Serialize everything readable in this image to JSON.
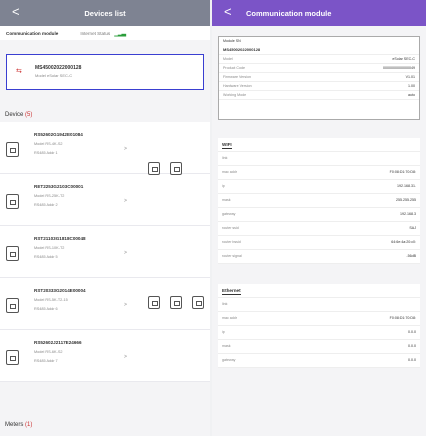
{
  "left": {
    "back": "<",
    "title": "Devices list",
    "tab_module": "Communication module",
    "tab_internet": "Internet Status",
    "module_card": {
      "sn": "MS45002022000128",
      "model": "Model eSolar SEC-C"
    },
    "device_title": "Device",
    "device_count": "(5)",
    "devices": [
      {
        "sn": "RS52602G1942E01084",
        "model": "Model RS-4K-S2",
        "addr": "RS485 Addr 1"
      },
      {
        "sn": "RET2253G2103C00001",
        "model": "Model RS-25K-T2",
        "addr": "RS485 Addr 2"
      },
      {
        "sn": "RST21103G1818C00048",
        "model": "Model RS-10K-T2",
        "addr": "RS485 Addr 5"
      },
      {
        "sn": "RST20333G2014E00004",
        "model": "Model RS-5K-T2-15",
        "addr": "RS485 Addr 6"
      },
      {
        "sn": "RS52602J2117E24666",
        "model": "Model RS-6K-S2",
        "addr": "RS485 Addr 7"
      }
    ],
    "meters_title": "Meters",
    "meters_count": "(1)"
  },
  "right": {
    "back": "<",
    "title": "Communication module",
    "module": {
      "sn_label": "Module SN",
      "sn": "MS45002022000128",
      "rows": [
        {
          "k": "Model",
          "v": "eSolar SEC-C"
        },
        {
          "k": "Product Code",
          "v": "0000000000000049"
        },
        {
          "k": "Firmware Version",
          "v": "V1.01"
        },
        {
          "k": "Hardware Version",
          "v": "1.00"
        },
        {
          "k": "Working Mode",
          "v": "auto"
        }
      ]
    },
    "wifi": {
      "title": "WIFI",
      "rows": [
        {
          "k": "link",
          "v": ""
        },
        {
          "k": "mac addr",
          "v": "F0:08:D1:70:D8:"
        },
        {
          "k": "ip",
          "v": "192.168.31."
        },
        {
          "k": "mask",
          "v": "255.255.255"
        },
        {
          "k": "gateway",
          "v": "192.168.3"
        },
        {
          "k": "router ssid",
          "v": "SAJ"
        },
        {
          "k": "router bssid",
          "v": "64:6e:4a:20:c0:"
        },
        {
          "k": "router signal",
          "v": "-56dB"
        }
      ]
    },
    "ethernet": {
      "title": "Ethernet",
      "rows": [
        {
          "k": "link",
          "v": ""
        },
        {
          "k": "mac addr",
          "v": "F0:08:D1:70:D8:"
        },
        {
          "k": "ip",
          "v": "0.0.0"
        },
        {
          "k": "mask",
          "v": "0.0.0"
        },
        {
          "k": "gateway",
          "v": "0.0.0"
        }
      ]
    }
  }
}
